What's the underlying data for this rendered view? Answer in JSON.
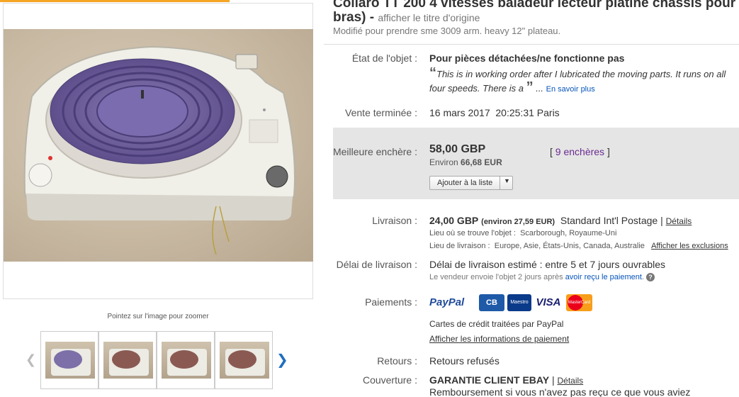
{
  "title": {
    "line1": "Collaro TT 200 4 vitesses baladeur lecteur platine châssis pour",
    "line2": "bras) -",
    "original_link": "afficher le titre d'origine",
    "subtitle": "Modifié pour prendre sme 3009 arm. heavy 12\" plateau."
  },
  "gallery": {
    "zoom_hint": "Pointez sur l'image pour zoomer",
    "thumbnails": [
      {
        "platter_color": "#7d6fa8"
      },
      {
        "platter_color": "#8a5a52"
      },
      {
        "platter_color": "#8a5a52"
      },
      {
        "platter_color": "#8a5a52"
      }
    ]
  },
  "condition": {
    "label": "État de l'objet :",
    "value": "Pour pièces détachées/ne fonctionne pas",
    "quote": "This is in working order after I lubricated the moving parts. It runs on all four speeds. There is a",
    "more": "En savoir plus"
  },
  "sale_end": {
    "label": "Vente terminée :",
    "date": "16 mars 2017",
    "time": "20:25:31 Paris"
  },
  "bid": {
    "label": "Meilleure enchère :",
    "price": "58,00 GBP",
    "approx_prefix": "Environ",
    "approx": "66,68 EUR",
    "count_link": "9 enchères",
    "watch_button": "Ajouter à la liste"
  },
  "shipping": {
    "label": "Livraison :",
    "price": "24,00 GBP",
    "approx": "(environ 27,59 EUR)",
    "service": "Standard Int'l Postage",
    "details": "Détails",
    "location_label": "Lieu où se trouve l'objet :",
    "location": "Scarborough, Royaume-Uni",
    "ship_to_label": "Lieu de livraison :",
    "ship_to": "Europe, Asie, États-Unis, Canada, Australie",
    "exclusions": "Afficher les exclusions"
  },
  "delivery": {
    "label": "Délai de livraison :",
    "estimate": "Délai de livraison estimé : entre 5 et 7 jours ouvrables",
    "note": "Le vendeur envoie l'objet 2 jours après",
    "note_link": "avoir reçu le paiement",
    "help": "?"
  },
  "payments": {
    "label": "Paiements :",
    "paypal": "PayPal",
    "cb": "CB",
    "maestro": "Maestro",
    "visa": "VISA",
    "mastercard": "MasterCard",
    "cards_note": "Cartes de crédit traitées par PayPal",
    "info_link": "Afficher les informations de paiement"
  },
  "returns": {
    "label": "Retours :",
    "value": "Retours refusés"
  },
  "coverage": {
    "label": "Couverture :",
    "value": "GARANTIE CLIENT EBAY",
    "details": "Détails",
    "note": "Remboursement si vous n'avez pas reçu ce que vous aviez"
  },
  "colors": {
    "link": "#0654ba",
    "accent": "#f5a623",
    "bid_bg": "#e5e5e5",
    "paypal_blue": "#1f4b99"
  }
}
